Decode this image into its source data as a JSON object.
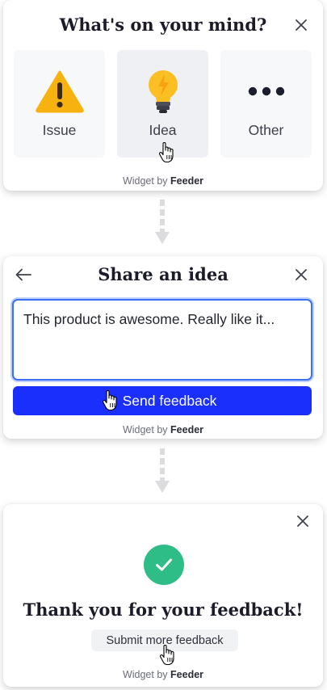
{
  "step1": {
    "title": "What's on your mind?",
    "options": [
      {
        "label": "Issue",
        "icon": "warning-icon"
      },
      {
        "label": "Idea",
        "icon": "lightbulb-icon"
      },
      {
        "label": "Other",
        "icon": "more-dots-icon"
      }
    ],
    "footer_prefix": "Widget by",
    "footer_brand": "Feeder"
  },
  "step2": {
    "title": "Share an idea",
    "textarea_value": "This product is awesome. Really like it...",
    "send_label": "Send feedback",
    "footer_prefix": "Widget by",
    "footer_brand": "Feeder"
  },
  "step3": {
    "title": "Thank you for your feedback!",
    "more_label": "Submit more feedback",
    "footer_prefix": "Widget by",
    "footer_brand": "Feeder"
  },
  "colors": {
    "primary": "#1a2efc",
    "success": "#2ebd86",
    "warning": "#f8b20f",
    "focus_border": "#3b6ff5"
  }
}
